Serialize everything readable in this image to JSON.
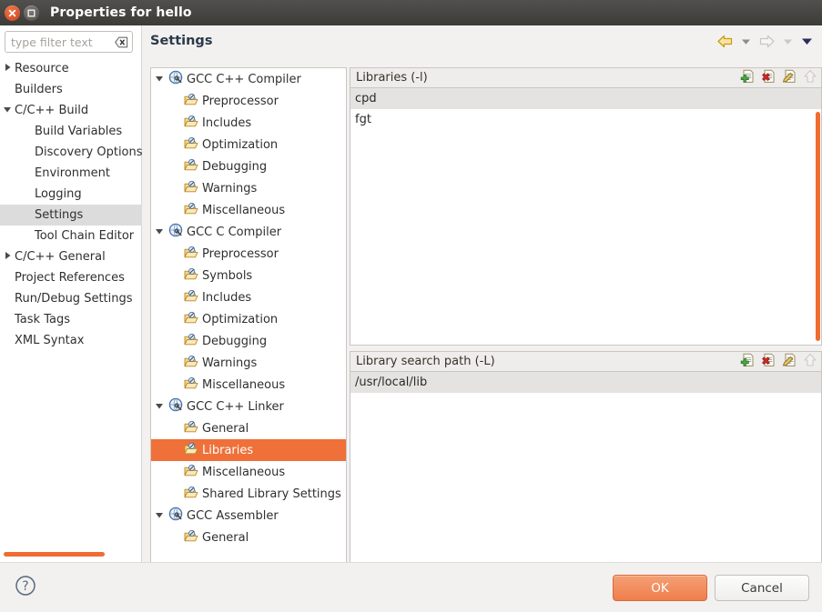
{
  "window": {
    "title": "Properties for hello",
    "close_icon": "close-icon",
    "maximize_icon": "maximize-icon"
  },
  "filter": {
    "placeholder": "type filter text",
    "value": "",
    "clear_icon": "clear-icon"
  },
  "sidebar": {
    "items": [
      {
        "label": "Resource",
        "depth": 0,
        "arrow": "collapsed",
        "selected": false
      },
      {
        "label": "Builders",
        "depth": 0,
        "arrow": "none",
        "selected": false
      },
      {
        "label": "C/C++ Build",
        "depth": 0,
        "arrow": "expanded",
        "selected": false
      },
      {
        "label": "Build Variables",
        "depth": 1,
        "arrow": "none",
        "selected": false
      },
      {
        "label": "Discovery Options",
        "depth": 1,
        "arrow": "none",
        "selected": false
      },
      {
        "label": "Environment",
        "depth": 1,
        "arrow": "none",
        "selected": false
      },
      {
        "label": "Logging",
        "depth": 1,
        "arrow": "none",
        "selected": false
      },
      {
        "label": "Settings",
        "depth": 1,
        "arrow": "none",
        "selected": true
      },
      {
        "label": "Tool Chain Editor",
        "depth": 1,
        "arrow": "none",
        "selected": false
      },
      {
        "label": "C/C++ General",
        "depth": 0,
        "arrow": "collapsed",
        "selected": false
      },
      {
        "label": "Project References",
        "depth": 0,
        "arrow": "none",
        "selected": false
      },
      {
        "label": "Run/Debug Settings",
        "depth": 0,
        "arrow": "none",
        "selected": false
      },
      {
        "label": "Task Tags",
        "depth": 0,
        "arrow": "none",
        "selected": false
      },
      {
        "label": "XML Syntax",
        "depth": 0,
        "arrow": "none",
        "selected": false
      }
    ]
  },
  "header": {
    "title": "Settings",
    "nav": [
      {
        "name": "back-arrow-icon",
        "state": "enabled"
      },
      {
        "name": "back-dropdown-icon",
        "state": "enabled"
      },
      {
        "name": "forward-arrow-icon",
        "state": "disabled"
      },
      {
        "name": "forward-dropdown-icon",
        "state": "disabled"
      },
      {
        "name": "view-menu-dropdown-icon",
        "state": "enabled"
      }
    ]
  },
  "settings_tree": {
    "items": [
      {
        "label": "GCC C++ Compiler",
        "depth": 1,
        "arrow": "expanded",
        "icon": "compiler-icon",
        "selected": false
      },
      {
        "label": "Preprocessor",
        "depth": 2,
        "arrow": "none",
        "icon": "folder-tool-icon",
        "selected": false
      },
      {
        "label": "Includes",
        "depth": 2,
        "arrow": "none",
        "icon": "folder-tool-icon",
        "selected": false
      },
      {
        "label": "Optimization",
        "depth": 2,
        "arrow": "none",
        "icon": "folder-tool-icon",
        "selected": false
      },
      {
        "label": "Debugging",
        "depth": 2,
        "arrow": "none",
        "icon": "folder-tool-icon",
        "selected": false
      },
      {
        "label": "Warnings",
        "depth": 2,
        "arrow": "none",
        "icon": "folder-tool-icon",
        "selected": false
      },
      {
        "label": "Miscellaneous",
        "depth": 2,
        "arrow": "none",
        "icon": "folder-tool-icon",
        "selected": false
      },
      {
        "label": "GCC C Compiler",
        "depth": 1,
        "arrow": "expanded",
        "icon": "compiler-icon",
        "selected": false
      },
      {
        "label": "Preprocessor",
        "depth": 2,
        "arrow": "none",
        "icon": "folder-tool-icon",
        "selected": false
      },
      {
        "label": "Symbols",
        "depth": 2,
        "arrow": "none",
        "icon": "folder-tool-icon",
        "selected": false
      },
      {
        "label": "Includes",
        "depth": 2,
        "arrow": "none",
        "icon": "folder-tool-icon",
        "selected": false
      },
      {
        "label": "Optimization",
        "depth": 2,
        "arrow": "none",
        "icon": "folder-tool-icon",
        "selected": false
      },
      {
        "label": "Debugging",
        "depth": 2,
        "arrow": "none",
        "icon": "folder-tool-icon",
        "selected": false
      },
      {
        "label": "Warnings",
        "depth": 2,
        "arrow": "none",
        "icon": "folder-tool-icon",
        "selected": false
      },
      {
        "label": "Miscellaneous",
        "depth": 2,
        "arrow": "none",
        "icon": "folder-tool-icon",
        "selected": false
      },
      {
        "label": "GCC C++ Linker",
        "depth": 1,
        "arrow": "expanded",
        "icon": "compiler-icon",
        "selected": false
      },
      {
        "label": "General",
        "depth": 2,
        "arrow": "none",
        "icon": "folder-tool-icon",
        "selected": false
      },
      {
        "label": "Libraries",
        "depth": 2,
        "arrow": "none",
        "icon": "folder-tool-icon",
        "selected": true
      },
      {
        "label": "Miscellaneous",
        "depth": 2,
        "arrow": "none",
        "icon": "folder-tool-icon",
        "selected": false
      },
      {
        "label": "Shared Library Settings",
        "depth": 2,
        "arrow": "none",
        "icon": "folder-tool-icon",
        "selected": false
      },
      {
        "label": "GCC Assembler",
        "depth": 1,
        "arrow": "expanded",
        "icon": "compiler-icon",
        "selected": false
      },
      {
        "label": "General",
        "depth": 2,
        "arrow": "none",
        "icon": "folder-tool-icon",
        "selected": false
      }
    ]
  },
  "libraries_group": {
    "title": "Libraries (-l)",
    "tools": [
      {
        "name": "add-icon",
        "state": "enabled"
      },
      {
        "name": "delete-icon",
        "state": "enabled"
      },
      {
        "name": "edit-icon",
        "state": "enabled"
      },
      {
        "name": "move-up-icon",
        "state": "disabled"
      }
    ],
    "rows": [
      {
        "value": "cpd",
        "highlighted": true
      },
      {
        "value": "fgt",
        "highlighted": false
      }
    ]
  },
  "search_path_group": {
    "title": "Library search path (-L)",
    "tools": [
      {
        "name": "add-icon",
        "state": "enabled"
      },
      {
        "name": "delete-icon",
        "state": "enabled"
      },
      {
        "name": "edit-icon",
        "state": "enabled"
      },
      {
        "name": "move-up-icon",
        "state": "disabled"
      }
    ],
    "rows": [
      {
        "value": "/usr/local/lib",
        "highlighted": true
      }
    ]
  },
  "footer": {
    "help_icon": "help-icon",
    "ok_label": "OK",
    "cancel_label": "Cancel"
  },
  "colors": {
    "accent_orange": "#ef7039",
    "scrollbar_orange": "#f06c30",
    "titlebar": "#3c3b37",
    "selection_gray": "#dcdcdc"
  }
}
